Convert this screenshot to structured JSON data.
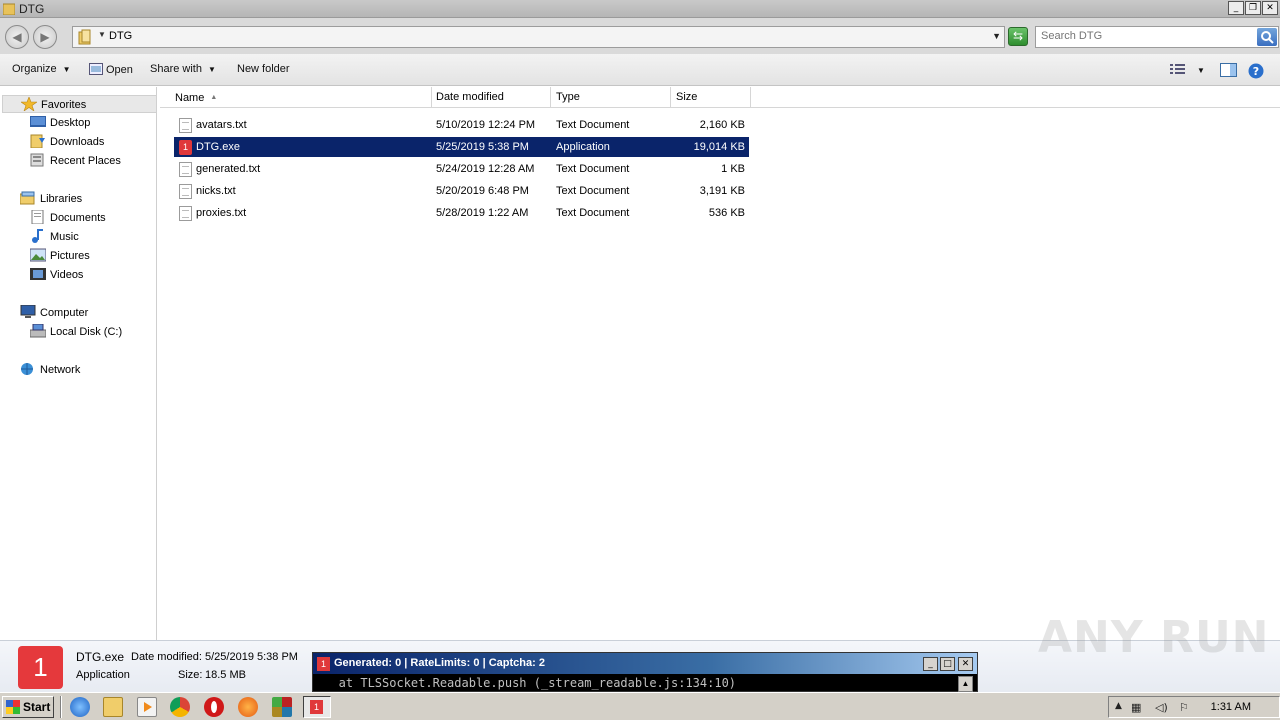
{
  "window": {
    "title": "DTG"
  },
  "address": {
    "crumb": "DTG"
  },
  "search": {
    "placeholder": "Search DTG"
  },
  "toolbar": {
    "organize": "Organize",
    "open": "Open",
    "share_with": "Share with",
    "new_folder": "New folder"
  },
  "nav": {
    "favorites": "Favorites",
    "desktop": "Desktop",
    "downloads": "Downloads",
    "recent_places": "Recent Places",
    "libraries": "Libraries",
    "documents": "Documents",
    "music": "Music",
    "pictures": "Pictures",
    "videos": "Videos",
    "computer": "Computer",
    "local_disk": "Local Disk (C:)",
    "network": "Network"
  },
  "columns": {
    "name": "Name",
    "date": "Date modified",
    "type": "Type",
    "size": "Size"
  },
  "files": [
    {
      "name": "avatars.txt",
      "date": "5/10/2019 12:24 PM",
      "type": "Text Document",
      "size": "2,160 KB",
      "icon": "text-file-icon"
    },
    {
      "name": "DTG.exe",
      "date": "5/25/2019 5:38 PM",
      "type": "Application",
      "size": "19,014 KB",
      "icon": "app-icon",
      "selected": true
    },
    {
      "name": "generated.txt",
      "date": "5/24/2019 12:28 AM",
      "type": "Text Document",
      "size": "1 KB",
      "icon": "text-file-icon"
    },
    {
      "name": "nicks.txt",
      "date": "5/20/2019 6:48 PM",
      "type": "Text Document",
      "size": "3,191 KB",
      "icon": "text-file-icon"
    },
    {
      "name": "proxies.txt",
      "date": "5/28/2019 1:22 AM",
      "type": "Text Document",
      "size": "536 KB",
      "icon": "text-file-icon"
    }
  ],
  "details": {
    "icon_glyph": "1",
    "name": "DTG.exe",
    "type": "Application",
    "date_label": "Date modified:",
    "date_value": "5/25/2019 5:38 PM",
    "size_label": "Size:",
    "size_value": "18.5 MB"
  },
  "console": {
    "title": "Generated: 0 | RateLimits: 0 | Captcha: 2",
    "line": "   at TLSSocket.Readable.push (_stream_readable.js:134:10)"
  },
  "taskbar": {
    "start": "Start",
    "clock": "1:31 AM"
  },
  "watermark": "ANY RUN",
  "colors": {
    "selection": "#0a246a",
    "app_red": "#e0383a"
  }
}
